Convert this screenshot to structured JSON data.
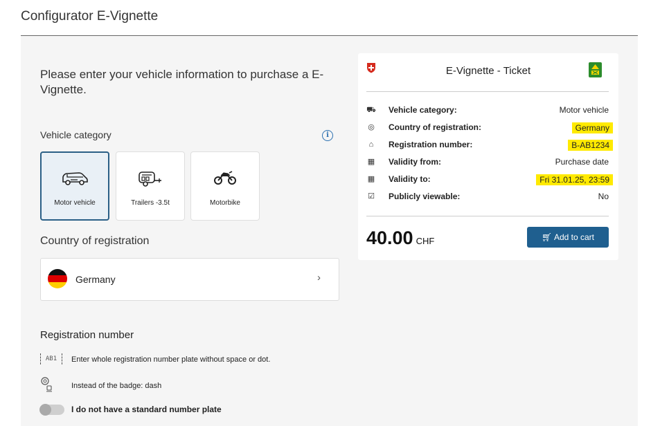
{
  "page": {
    "title": "Configurator E-Vignette"
  },
  "intro": {
    "text": "Please enter your vehicle information to purchase a E-Vignette."
  },
  "vehicle_category": {
    "label": "Vehicle category",
    "options": [
      {
        "label": "Motor vehicle",
        "icon": "car-icon",
        "selected": true
      },
      {
        "label": "Trailers -3.5t",
        "icon": "trailer-icon",
        "selected": false
      },
      {
        "label": "Motorbike",
        "icon": "motorbike-icon",
        "selected": false
      }
    ]
  },
  "country": {
    "label": "Country of registration",
    "value": "Germany",
    "chevron": "›"
  },
  "registration": {
    "label": "Registration number",
    "hint1_icon_text": "AB1",
    "hint1": "Enter whole registration number plate without space or dot.",
    "hint2": "Instead of the badge: dash",
    "toggle_label": "I do not have a standard number plate"
  },
  "ticket": {
    "title": "E-Vignette - Ticket",
    "rows": [
      {
        "key": "Vehicle category:",
        "value": "Motor vehicle",
        "icon": "truck-icon"
      },
      {
        "key": "Country of registration:",
        "value": "Germany",
        "icon": "location-pin-icon"
      },
      {
        "key": "Registration number:",
        "value": "B-AB1234",
        "icon": "tag-icon"
      },
      {
        "key": "Validity from:",
        "value": "Purchase date",
        "icon": "calendar-icon"
      },
      {
        "key": "Validity to:",
        "value": "Fri 31.01.25, 23:59",
        "icon": "calendar-icon"
      },
      {
        "key": "Publicly viewable:",
        "value": "No",
        "icon": "checkbox-icon"
      }
    ],
    "price": "40.00",
    "currency": "CHF",
    "add_to_cart": "Add to cart"
  },
  "colors": {
    "accent": "#1f5f8f",
    "highlight": "#ffea00",
    "selected_border": "#2a5f86"
  }
}
